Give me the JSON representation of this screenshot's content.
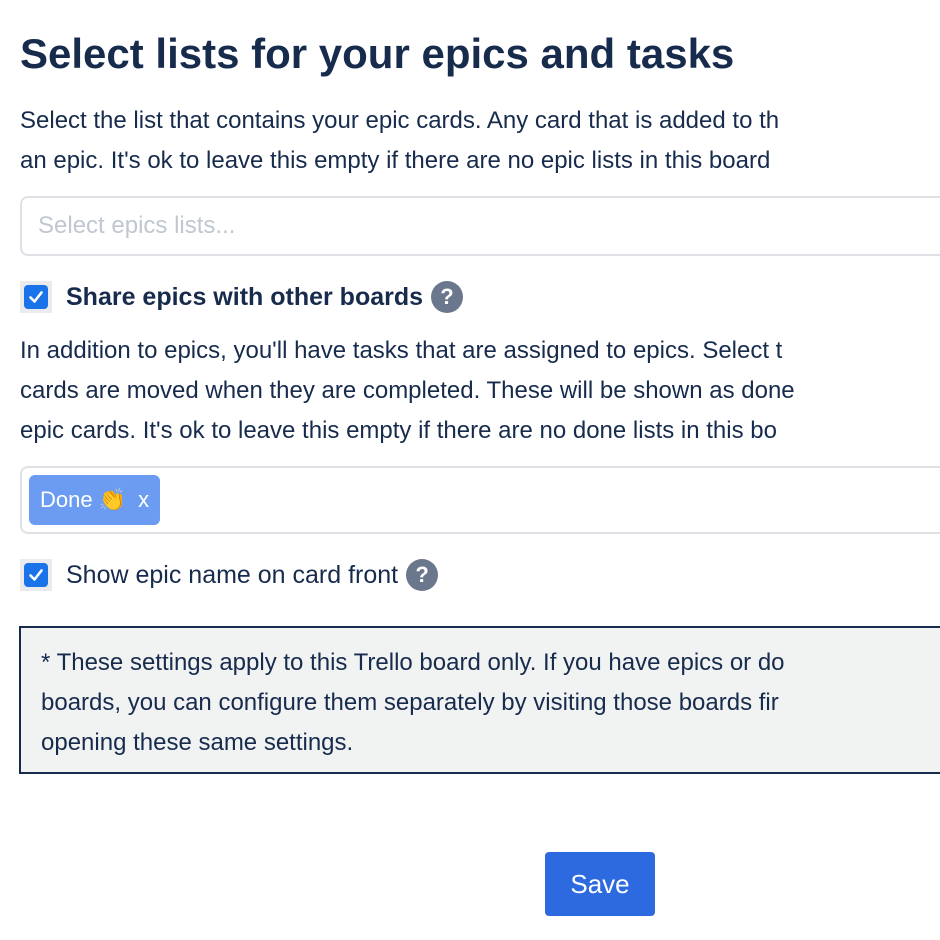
{
  "title": "Select lists for your epics and tasks",
  "epics": {
    "description_lines": [
      "Select the list that contains your epic cards. Any card that is added to th",
      "an epic. It's ok to leave this empty if there are no epic lists in this board"
    ],
    "select_placeholder": "Select epics lists...",
    "select_value": ""
  },
  "share_epics": {
    "checked": true,
    "label": "Share epics with other boards",
    "help": "?"
  },
  "done": {
    "description_lines": [
      "In addition to epics, you'll have tasks that are assigned to epics. Select t",
      "cards are moved when they are completed. These will be shown as done",
      "epic cards. It's ok to leave this empty if there are no done lists in this bo"
    ],
    "selected_chips": [
      {
        "label": "Done 👏",
        "remove": "x"
      }
    ]
  },
  "show_epic_name": {
    "checked": true,
    "label": "Show epic name on card front",
    "help": "?"
  },
  "note": {
    "lines": [
      "* These settings apply to this Trello board only. If you have epics or do",
      "boards, you can configure them separately by visiting those boards fir",
      "opening these same settings."
    ]
  },
  "save_label": "Save",
  "colors": {
    "text": "#172b4d",
    "accent": "#2d6ae0",
    "chip": "#6b9cf2",
    "checkbox": "#1a73e8",
    "help_icon": "#6b778c",
    "note_bg": "#f1f2f2"
  }
}
